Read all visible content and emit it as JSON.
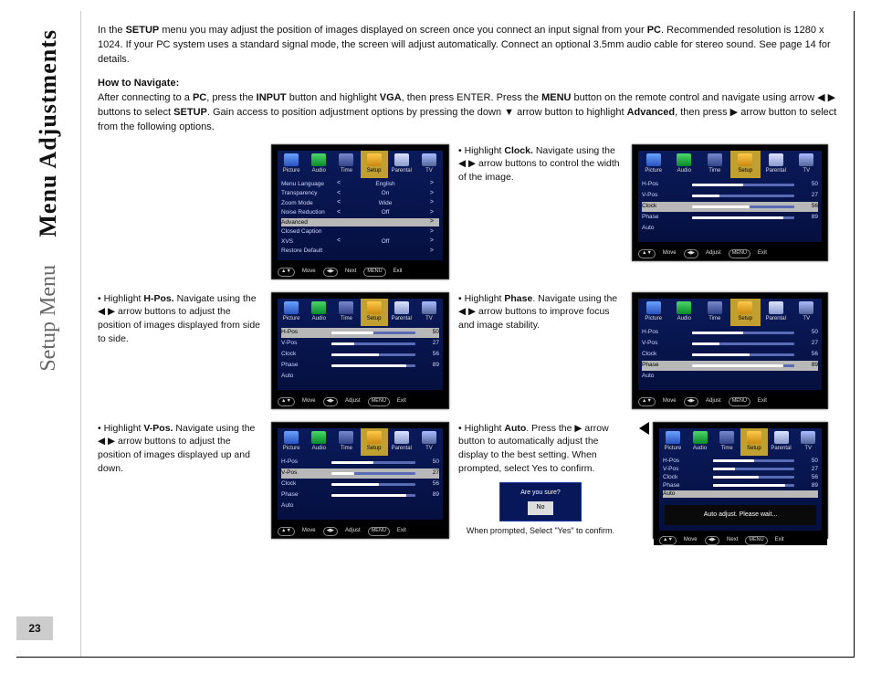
{
  "page_number": "23",
  "sidebar": {
    "title": "Menu Adjustments",
    "subtitle": "Setup Menu"
  },
  "intro": {
    "pre": "In the ",
    "b1": "SETUP",
    "mid1": " menu you may adjust the position of images displayed on screen once you connect an input signal from your ",
    "b2": "PC",
    "post": ". Recommended resolution is 1280 x 1024. If your PC system uses a standard signal mode, the screen will adjust automatically. Connect an optional 3.5mm audio cable for stereo sound. See page 14 for details."
  },
  "nav_heading": "How to Navigate:",
  "nav": {
    "s1": "After connecting to a ",
    "b1": "PC",
    "s2": ", press the ",
    "b2": "INPUT",
    "s3": " button and highlight ",
    "b3": "VGA",
    "s4": ", then press ENTER. Press the ",
    "b4": "MENU",
    "s5": " button on the remote control and navigate using arrow ◀ ▶ buttons to select ",
    "b5": "SETUP",
    "s6": ". Gain access to position adjustment options by pressing the down ▼ arrow button to highlight ",
    "b6": "Advanced",
    "s7": ", then press ▶ arrow button to select from the following options."
  },
  "osd_tabs": [
    "Picture",
    "Audio",
    "Time",
    "Setup",
    "Parental",
    "TV"
  ],
  "osd_footer": {
    "move": "Move",
    "adjust": "Adjust",
    "next": "Next",
    "exit": "Exit",
    "k1": "▲▼",
    "k2": "◀▶",
    "k3": "MENU"
  },
  "setup_list": [
    {
      "name": "Menu Language",
      "left": "<",
      "val": "English",
      "right": ">"
    },
    {
      "name": "Transparency",
      "left": "<",
      "val": "On",
      "right": ">"
    },
    {
      "name": "Zoom Mode",
      "left": "<",
      "val": "Wide",
      "right": ">"
    },
    {
      "name": "Noise Reduction",
      "left": "<",
      "val": "Off",
      "right": ">"
    },
    {
      "name": "Advanced",
      "left": "",
      "val": "",
      "right": ">",
      "hl": true
    },
    {
      "name": "Closed Caption",
      "left": "",
      "val": "",
      "right": ">"
    },
    {
      "name": "XVS",
      "left": "<",
      "val": "Off",
      "right": ">"
    },
    {
      "name": "Restore Default",
      "left": "",
      "val": "",
      "right": ">"
    }
  ],
  "items": {
    "hpos": {
      "label": "H-Pos.",
      "text": "Navigate using the ◀ ▶ arrow buttons to adjust the position of images displayed from side to side."
    },
    "vpos": {
      "label": "V-Pos.",
      "text": "Navigate using the ◀ ▶ arrow buttons to adjust the position of images displayed up and down."
    },
    "clock": {
      "label": "Clock.",
      "text": "Navigate using the ◀ ▶ arrow buttons to control the width of the image."
    },
    "phase": {
      "label": "Phase",
      "text": ". Navigate using the ◀ ▶ arrow buttons to improve focus and image stability."
    },
    "auto": {
      "label": "Auto",
      "text": ". Press the ▶ arrow button to automatically adjust the display to the best setting. When prompted, select Yes to confirm."
    }
  },
  "confirm_note": "When prompted, Select \"Yes\" to confirm.",
  "prompt": {
    "q": "Are you sure?",
    "no": "No"
  },
  "auto_status": "Auto adjust. Please wait...",
  "chart_data": {
    "type": "table",
    "rows_labels": [
      "H-Pos",
      "V-Pos",
      "Clock",
      "Phase",
      "Auto"
    ],
    "screens": {
      "hpos": {
        "H-Pos": 50,
        "V-Pos": 27,
        "Clock": 56,
        "Phase": 89,
        "Auto": null,
        "highlight": "H-Pos"
      },
      "vpos": {
        "H-Pos": 50,
        "V-Pos": 27,
        "Clock": 56,
        "Phase": 89,
        "Auto": null,
        "highlight": "V-Pos"
      },
      "clock": {
        "H-Pos": 50,
        "V-Pos": 27,
        "Clock": 56,
        "Phase": 89,
        "Auto": null,
        "highlight": "Clock"
      },
      "phase": {
        "H-Pos": 50,
        "V-Pos": 27,
        "Clock": 56,
        "Phase": 89,
        "Auto": null,
        "highlight": "Phase"
      },
      "auto": {
        "H-Pos": 50,
        "V-Pos": 27,
        "Clock": 56,
        "Phase": 89,
        "Auto": null,
        "highlight": "Auto"
      }
    }
  }
}
